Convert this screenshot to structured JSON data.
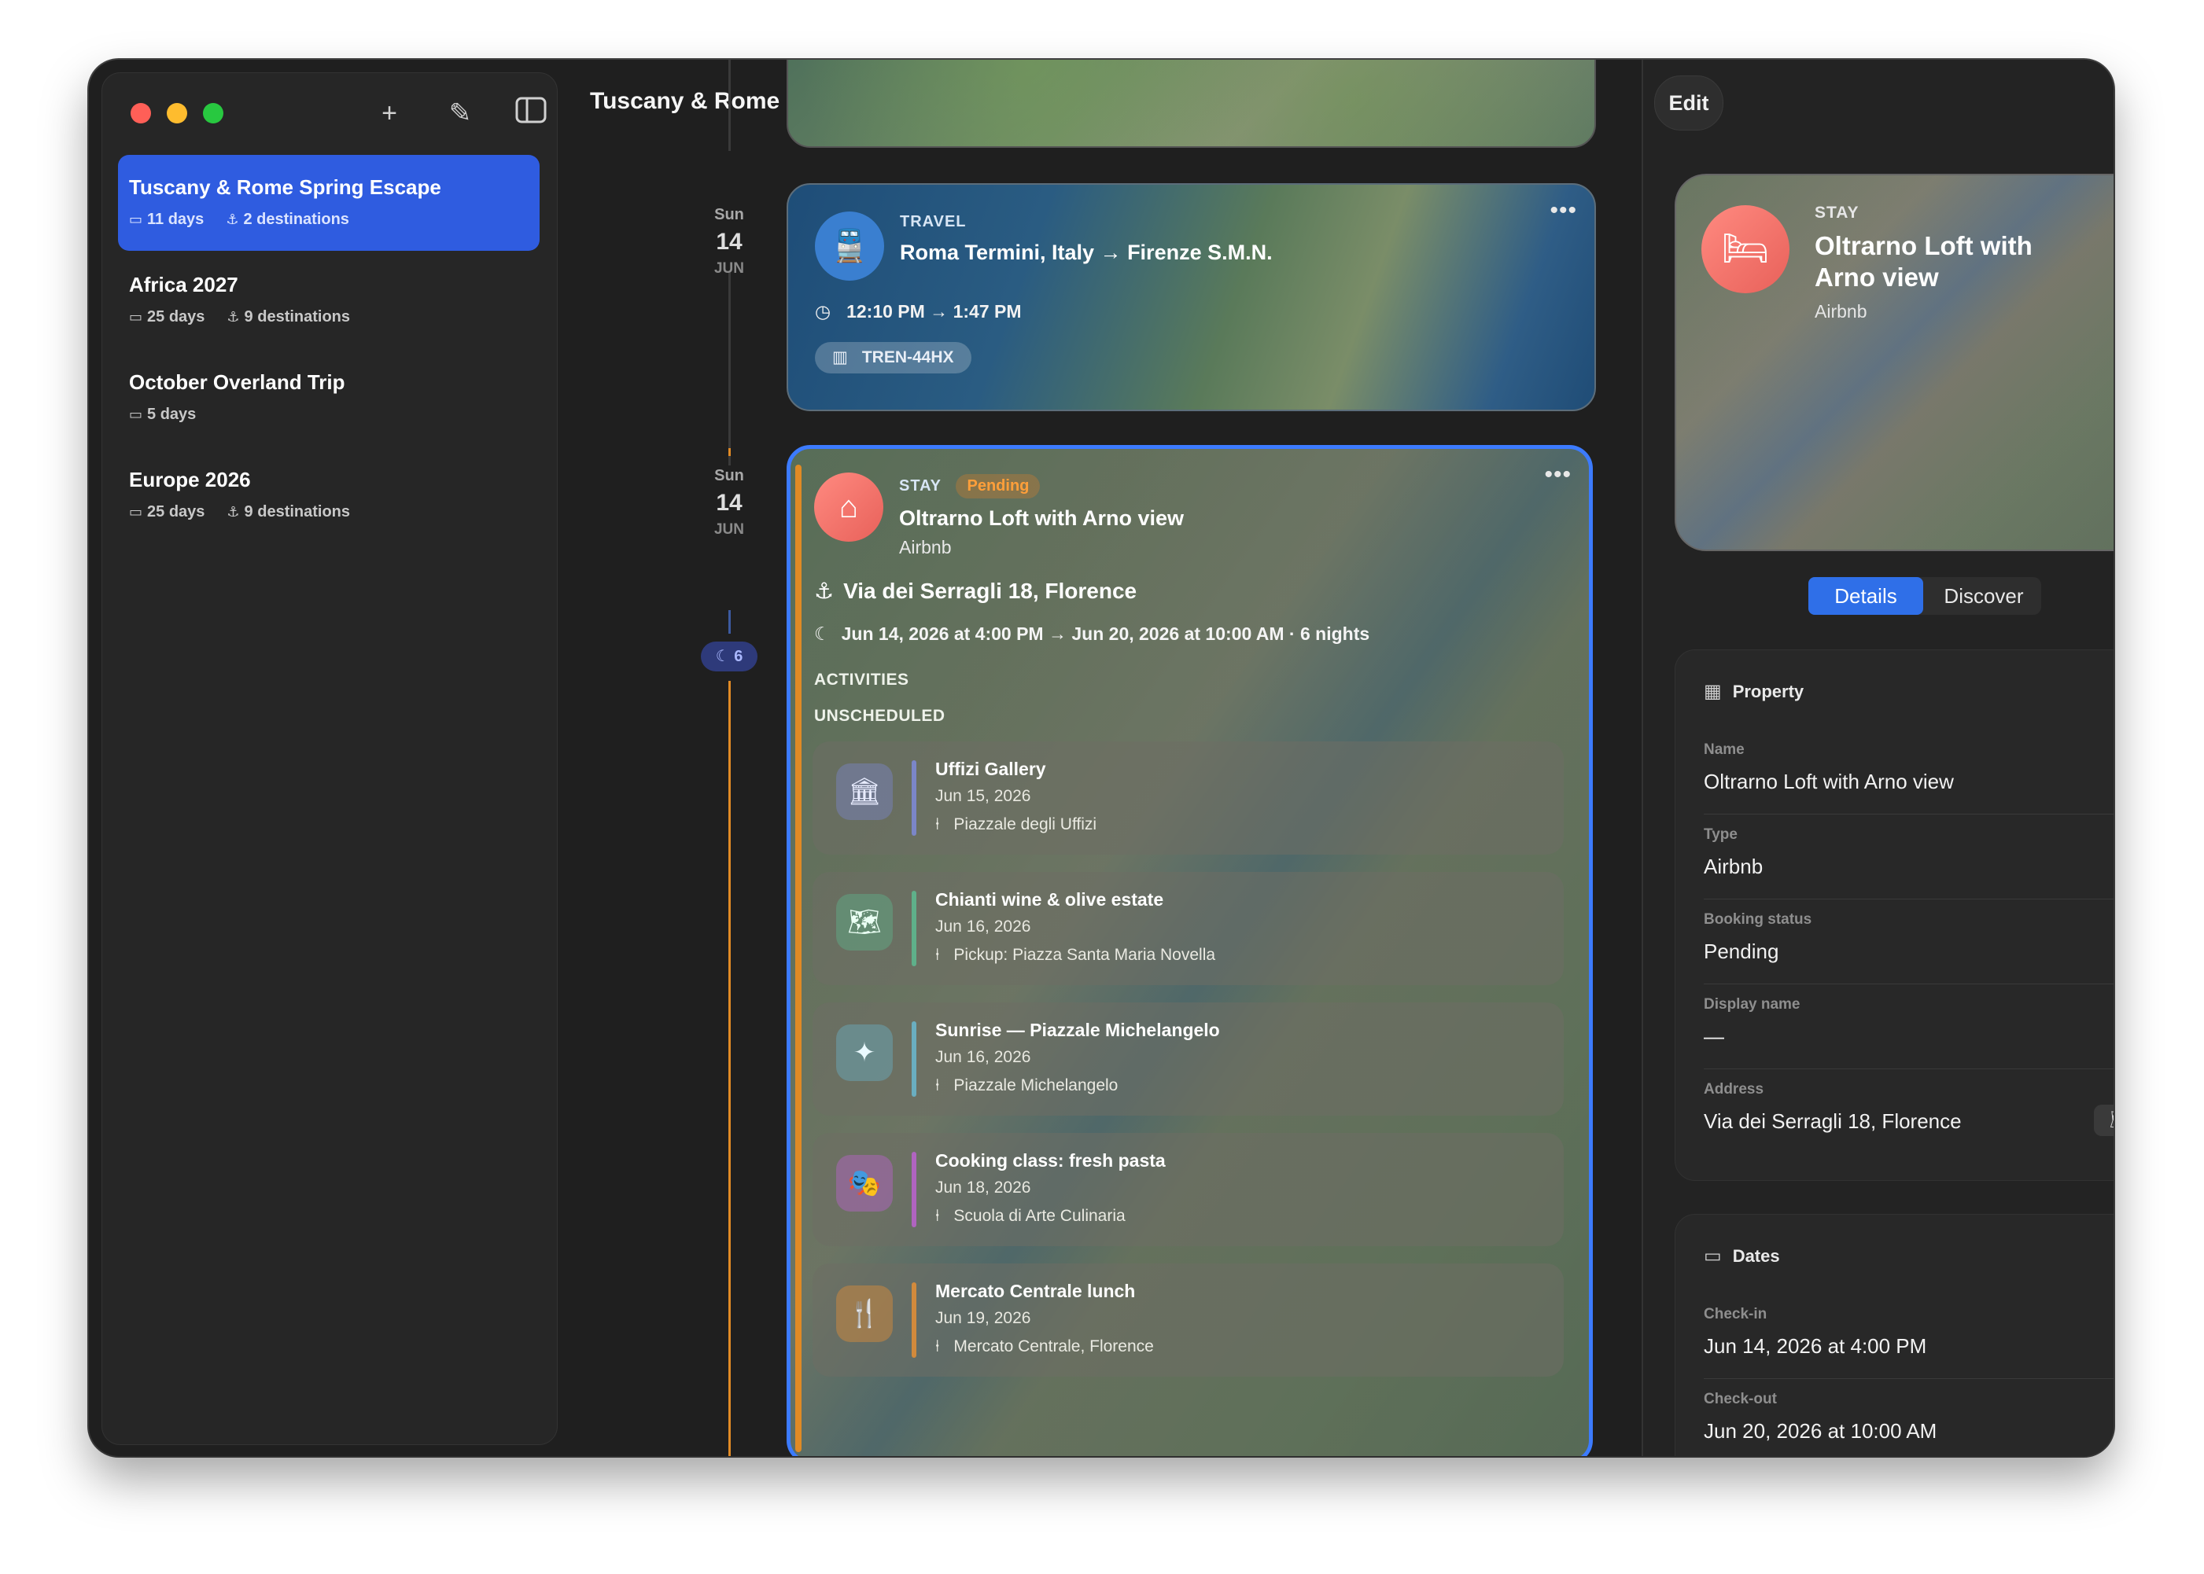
{
  "sidebar": {
    "trips": [
      {
        "name": "Tuscany & Rome Spring Escape",
        "days": "11 days",
        "destinations": "2 destinations"
      },
      {
        "name": "Africa 2027",
        "days": "25 days",
        "destinations": "9 destinations"
      },
      {
        "name": "October Overland Trip",
        "days": "5 days",
        "destinations": ""
      },
      {
        "name": "Europe 2026",
        "days": "25 days",
        "destinations": "9 destinations"
      }
    ]
  },
  "header": {
    "title": "Tuscany & Rome Spring Escape"
  },
  "timeline": {
    "dates": [
      {
        "dow": "Sun",
        "day": "14",
        "mon": "JUN"
      },
      {
        "dow": "Sun",
        "day": "14",
        "mon": "JUN"
      }
    ],
    "nights_badge": "6"
  },
  "travel_card": {
    "kicker": "TRAVEL",
    "title": "Roma Termini, Italy → Firenze S.M.N.",
    "time": "12:10 PM → 1:47 PM",
    "code": "TREN-44HX"
  },
  "stay_card": {
    "kicker": "STAY",
    "status": "Pending",
    "title": "Oltrarno Loft with Arno view",
    "provider": "Airbnb",
    "address": "Via dei Serragli 18, Florence",
    "dates": "Jun 14, 2026 at 4:00 PM → Jun 20, 2026 at 10:00 AM · 6 nights",
    "activities_label": "ACTIVITIES",
    "unscheduled_label": "UNSCHEDULED",
    "activities": [
      {
        "title": "Uffizi Gallery",
        "date": "Jun 15, 2026",
        "location": "Piazzale degli Uffizi",
        "icon": "museum-icon",
        "color": "#7b86c8"
      },
      {
        "title": "Chianti wine & olive estate",
        "date": "Jun 16, 2026",
        "location": "Pickup: Piazza Santa Maria Novella",
        "icon": "map-icon",
        "color": "#5fb08a"
      },
      {
        "title": "Sunrise — Piazzale Michelangelo",
        "date": "Jun 16, 2026",
        "location": "Piazzale Michelangelo",
        "icon": "sparkle-icon",
        "color": "#6aaec0"
      },
      {
        "title": "Cooking class: fresh pasta",
        "date": "Jun 18, 2026",
        "location": "Scuola di Arte Culinaria",
        "icon": "theater-masks-icon",
        "color": "#b064c0"
      },
      {
        "title": "Mercato Centrale lunch",
        "date": "Jun 19, 2026",
        "location": "Mercato Centrale, Florence",
        "icon": "fork-knife-icon",
        "color": "#d28a3c"
      }
    ]
  },
  "detail": {
    "edit_label": "Edit",
    "hero": {
      "kicker": "STAY",
      "title": "Oltrarno Loft with Arno view",
      "provider": "Airbnb"
    },
    "tabs": [
      "Details",
      "Discover"
    ],
    "property": {
      "heading": "Property",
      "fields": [
        {
          "label": "Name",
          "value": "Oltrarno Loft with Arno view"
        },
        {
          "label": "Type",
          "value": "Airbnb"
        },
        {
          "label": "Booking status",
          "value": "Pending"
        },
        {
          "label": "Display name",
          "value": "—"
        },
        {
          "label": "Address",
          "value": "Via dei Serragli 18, Florence"
        }
      ]
    },
    "dates": {
      "heading": "Dates",
      "fields": [
        {
          "label": "Check-in",
          "value": "Jun 14, 2026 at 4:00 PM"
        },
        {
          "label": "Check-out",
          "value": "Jun 20, 2026 at 10:00 AM"
        }
      ]
    }
  }
}
